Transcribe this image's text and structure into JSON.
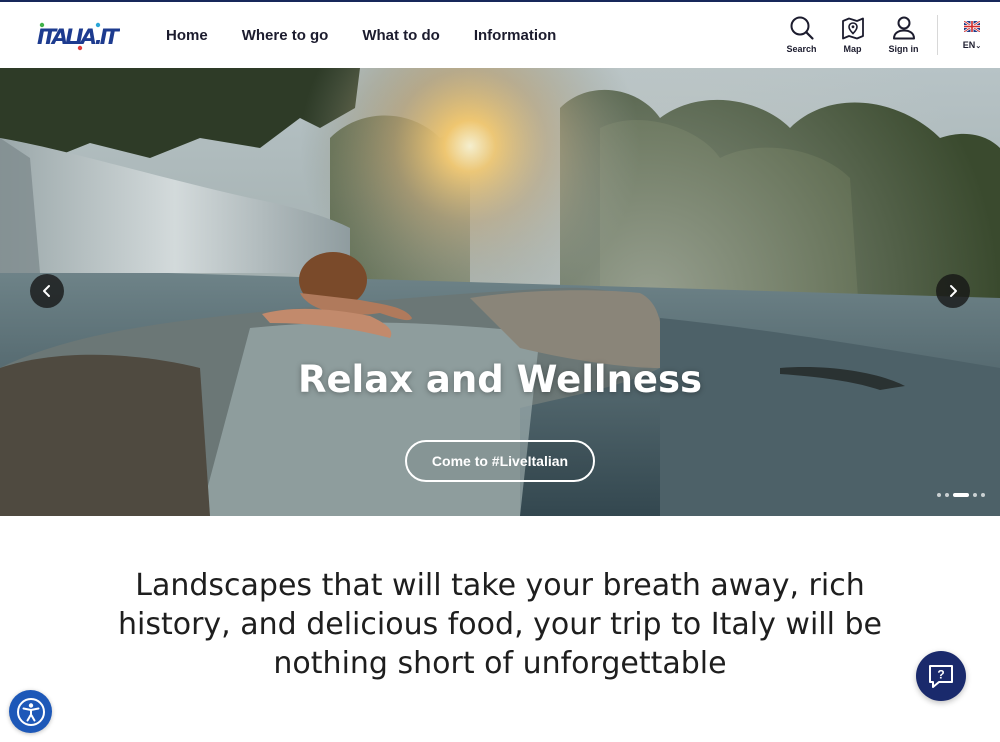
{
  "brand": {
    "logo_text": "ITALIA.IT"
  },
  "nav": {
    "items": [
      {
        "label": "Home"
      },
      {
        "label": "Where to go"
      },
      {
        "label": "What to do"
      },
      {
        "label": "Information"
      }
    ]
  },
  "tools": {
    "search_label": "Search",
    "map_label": "Map",
    "signin_label": "Sign in",
    "language_label": "EN"
  },
  "hero": {
    "title": "Relax and Wellness",
    "cta_label": "Come to #LiveItalian",
    "slide_count": 5,
    "active_slide": 3
  },
  "intro": {
    "text": "Landscapes that will take your breath away, rich history, and delicious food, your trip to Italy will be nothing short of unforgettable"
  },
  "colors": {
    "nav_text": "#1c1c2e",
    "brand_blue": "#1d3b8f",
    "chat_button": "#1a2a6c",
    "accessibility_button": "#1d58b8"
  },
  "icons": {
    "search": "search-icon",
    "map": "map-pin-icon",
    "signin": "user-icon",
    "language": "uk-flag-icon",
    "prev": "chevron-left-icon",
    "next": "chevron-right-icon",
    "accessibility": "accessibility-icon",
    "chat": "chat-help-icon"
  }
}
